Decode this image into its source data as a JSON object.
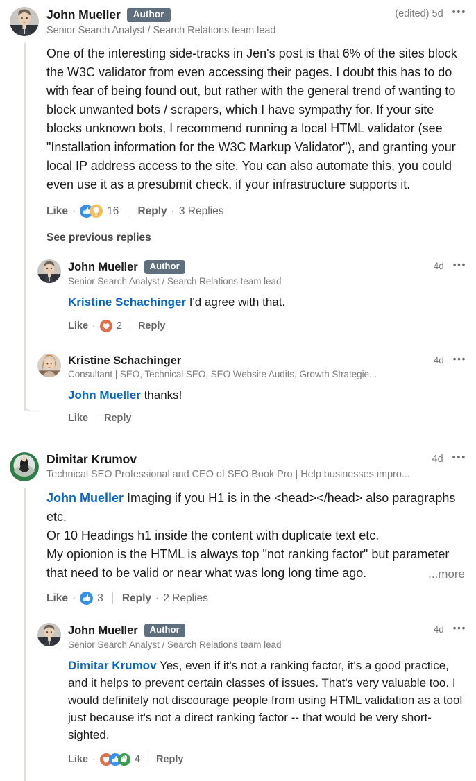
{
  "theme": {
    "link_color": "#0a66c2",
    "author_badge_bg": "#5f6f7e",
    "muted_text": "#7d7d7d",
    "thread_line": "#e3e0dc"
  },
  "see_previous_replies": "See previous replies",
  "comments": [
    {
      "id": "main",
      "author": "John Mueller",
      "badge": "Author",
      "headline": "Senior Search Analyst / Search Relations team lead",
      "timestamp": "(edited) 5d",
      "menu": "•••",
      "body": "One of the interesting side-tracks in Jen's post is that 6% of the sites block the W3C validator from even accessing their pages. I doubt this has to do with fear of being found out, but rather with the general trend of wanting to block unwanted bots / scrapers, which I have sympathy for. If your site blocks unknown bots, I recommend running a local HTML validator (see \"Installation information for the W3C Markup Validator\"), and granting your local IP address access to the site. You can also automate this, you could even use it as a presubmit check, if your infrastructure supports it.",
      "actions": {
        "like": "Like",
        "reply": "Reply",
        "reaction_count": "16",
        "reactions": [
          "like-icon",
          "insight-icon"
        ],
        "replies_label": "3 Replies"
      }
    },
    {
      "id": "r-1",
      "author": "John Mueller",
      "badge": "Author",
      "headline": "Senior Search Analyst / Search Relations team lead",
      "timestamp": "4d",
      "menu": "•••",
      "mention": "Kristine Schachinger",
      "body": " I'd agree with that.",
      "actions": {
        "like": "Like",
        "reply": "Reply",
        "reaction_count": "2",
        "reactions": [
          "love-icon"
        ],
        "replies_label": ""
      }
    },
    {
      "id": "r-2",
      "author": "Kristine Schachinger",
      "badge": "",
      "headline": "Consultant | SEO, Technical SEO, SEO Website Audits, Growth Strategie...",
      "timestamp": "4d",
      "menu": "•••",
      "mention": "John Mueller",
      "body": " thanks!",
      "actions": {
        "like": "Like",
        "reply": "Reply",
        "reaction_count": "",
        "reactions": [],
        "replies_label": ""
      }
    },
    {
      "id": "c-2",
      "author": "Dimitar Krumov",
      "badge": "",
      "headline": "Technical SEO Professional and CEO of SEO Book Pro | Help businesses impro...",
      "timestamp": "4d",
      "menu": "•••",
      "mention": "John Mueller",
      "body": " Imaging if you H1 is in the <head></head> also paragraphs etc.\nOr 10 Headings h1 inside the content with duplicate text etc.\nMy opionion is the HTML is always top \"not ranking factor\" but parameter that need to be valid or near what was long long time ago.",
      "more_label": "...more",
      "actions": {
        "like": "Like",
        "reply": "Reply",
        "reaction_count": "3",
        "reactions": [
          "like-icon"
        ],
        "replies_label": "2 Replies"
      }
    },
    {
      "id": "r-3",
      "author": "John Mueller",
      "badge": "Author",
      "headline": "Senior Search Analyst / Search Relations team lead",
      "timestamp": "4d",
      "menu": "•••",
      "mention": "Dimitar Krumov",
      "body": " Yes, even if it's not a ranking factor, it's a good practice, and it helps to prevent certain classes of issues. That's very valuable too. I would definitely not discourage people from using HTML validation as a tool just because it's not a direct ranking factor -- that would be very short-sighted.",
      "actions": {
        "like": "Like",
        "reply": "Reply",
        "reaction_count": "4",
        "reactions": [
          "love-icon",
          "like-icon",
          "support-icon"
        ],
        "replies_label": ""
      }
    }
  ]
}
